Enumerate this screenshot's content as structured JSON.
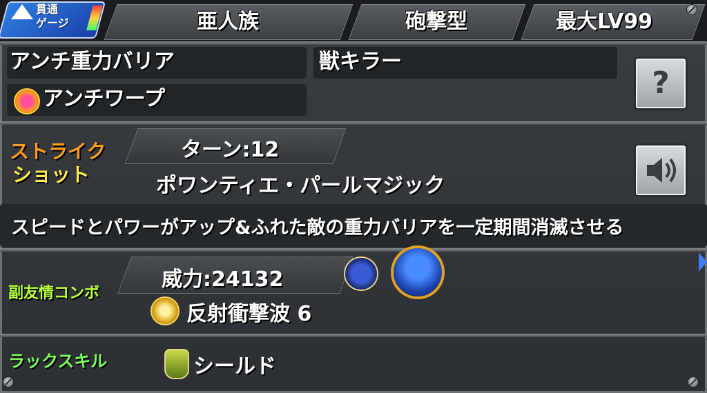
{
  "header": {
    "badge_line1": "貫通",
    "badge_line2": "ゲージ",
    "race": "亜人族",
    "battle_type": "砲撃型",
    "max_level": "最大LV99"
  },
  "abilities": {
    "ability_1": "アンチ重力バリア",
    "ability_2": "獣キラー",
    "gauge_ability": "アンチワープ",
    "help_icon": "question-icon"
  },
  "strike_shot": {
    "label_line1": "ストライク",
    "label_line2": "ショット",
    "turns": "ターン:12",
    "name": "ポワンティエ・パールマジック",
    "description": "スピードとパワーがアップ&ふれた敵の重力バリアを一定期間消滅させる",
    "voice_icon": "speaker-icon"
  },
  "sub_combo": {
    "label": "副友情コンボ",
    "power": "威力:24132",
    "name": "反射衝撃波 6"
  },
  "luck_skill": {
    "label": "ラックスキル",
    "name": "シールド"
  },
  "colors": {
    "strike_label_top": "#ff9a1f",
    "strike_label_bottom": "#ffe94a",
    "sub_combo_label": "#b6ff3a",
    "luck_label": "#7dff5a"
  }
}
